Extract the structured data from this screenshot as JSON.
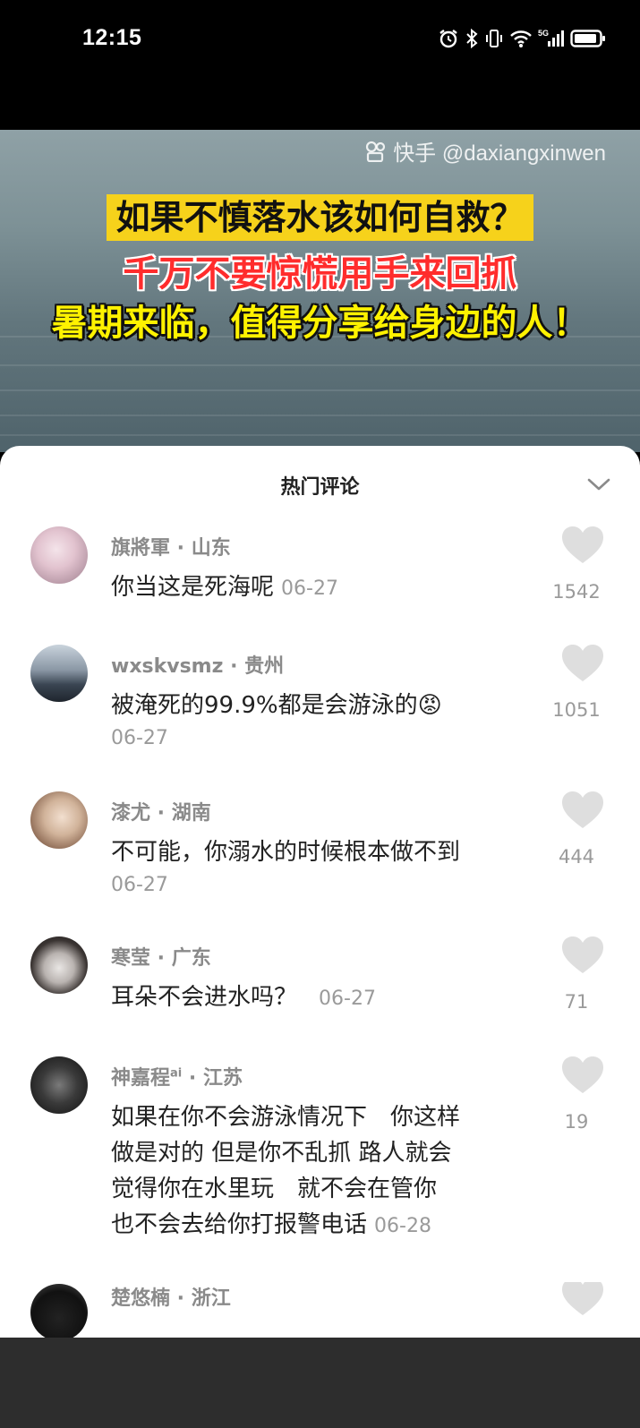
{
  "status_bar": {
    "time": "12:15",
    "icons": [
      "alarm-icon",
      "bluetooth-icon",
      "vibrate-icon",
      "wifi-icon",
      "signal-5g-icon",
      "battery-icon"
    ],
    "network": "5G"
  },
  "video": {
    "watermark": "快手 @daxiangxinwen",
    "caption_line1": "如果不慎落水该如何自救？",
    "caption_line2": "千万不要惊慌用手来回抓",
    "caption_line3": "暑期来临，值得分享给身边的人！"
  },
  "comments_panel": {
    "title": "热门评论",
    "collapse_icon": "chevron-down-icon",
    "comments": [
      {
        "user": "旗將軍",
        "location": "山东",
        "text": "你当这是死海呢",
        "date": "06-27",
        "likes": "1542"
      },
      {
        "user": "wxskvsmz",
        "location": "贵州",
        "text": "被淹死的99.9%都是会游泳的😡",
        "date": "06-27",
        "likes": "1051"
      },
      {
        "user": "漆尤",
        "location": "湖南",
        "text": "不可能，你溺水的时候根本做不到",
        "date": "06-27",
        "likes": "444"
      },
      {
        "user": "寒莹",
        "location": "广东",
        "text": "耳朵不会进水吗？",
        "date": "06-27",
        "likes": "71"
      },
      {
        "user": "神嘉程",
        "user_sup": "ai",
        "location": "江苏",
        "text_lines": [
          "如果在你不会游泳情况下　你这样",
          "做是对的  但是你不乱抓 路人就会",
          "觉得你在水里玩　就不会在管你",
          "也不会去给你打报警电话"
        ],
        "date": "06-28",
        "likes": "19"
      },
      {
        "user": "楚悠楠",
        "location": "浙江"
      }
    ]
  },
  "colors": {
    "caption_highlight": "#f6d21b",
    "caption_red": "#ff2c2c",
    "caption_yellow": "#fff200",
    "like_heart": "#dedede"
  }
}
